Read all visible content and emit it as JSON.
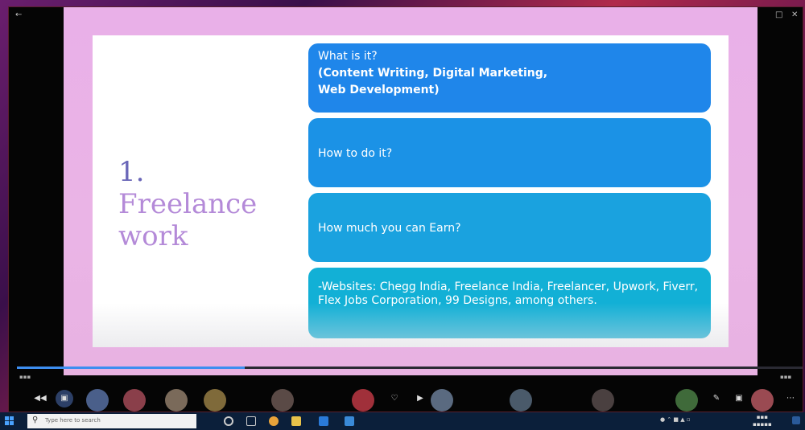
{
  "slide": {
    "title_number": "1.",
    "title_line1": "Freelance",
    "title_line2": "work",
    "cards": {
      "what_label": "What is it?",
      "what_detail_line1": "(Content Writing, Digital Marketing,",
      "what_detail_line2": "Web Development)",
      "how": "How to do it?",
      "earn": "How much you can Earn?",
      "sites": "-Websites: Chegg India, Freelance India, Freelancer, Upwork, Fiverr, Flex Jobs Corporation, 99 Designs, among others."
    }
  },
  "playback": {
    "progress_percent": 29
  },
  "taskbar": {
    "search_placeholder": "Type here to search"
  },
  "colors": {
    "card1": "#1f86ea",
    "card2": "#1b92e6",
    "card3": "#1aa2df",
    "card4": "#12b0d6",
    "slide_background": "#e9b0e8",
    "progress": "#3d8ef0"
  }
}
